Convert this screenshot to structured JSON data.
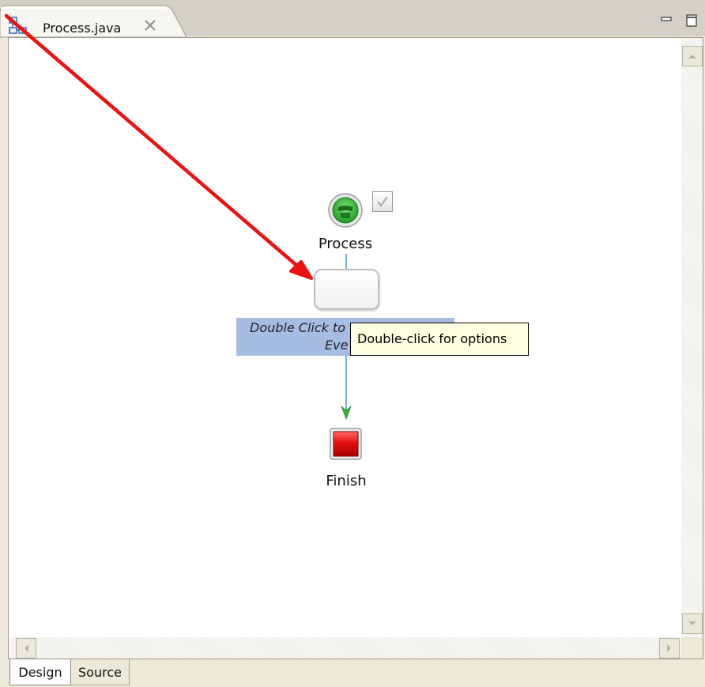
{
  "editor_tab": {
    "title": "Process.java",
    "icon": "process-diagram-icon",
    "close_icon": "close-icon"
  },
  "window_controls": {
    "minimize_icon": "minimize-icon",
    "maximize_icon": "maximize-icon"
  },
  "diagram": {
    "start_node": {
      "label": "Process",
      "icon": "start-node-icon"
    },
    "activity_node": {
      "text_line1": "Double Click to",
      "text_line2": "Eve"
    },
    "finish_node": {
      "label": "Finish",
      "icon": "finish-node-icon"
    },
    "tooltip": "Double-click for options"
  },
  "bottom_tabs": [
    {
      "label": "Design",
      "active": true
    },
    {
      "label": "Source",
      "active": false
    }
  ],
  "colors": {
    "annotation_arrow": "#ee1111",
    "connector": "#4a90d9",
    "selection": "#a7bce2",
    "tooltip_bg": "#ffffe1",
    "start_green": "#22aa22",
    "finish_red": "#e01010"
  }
}
